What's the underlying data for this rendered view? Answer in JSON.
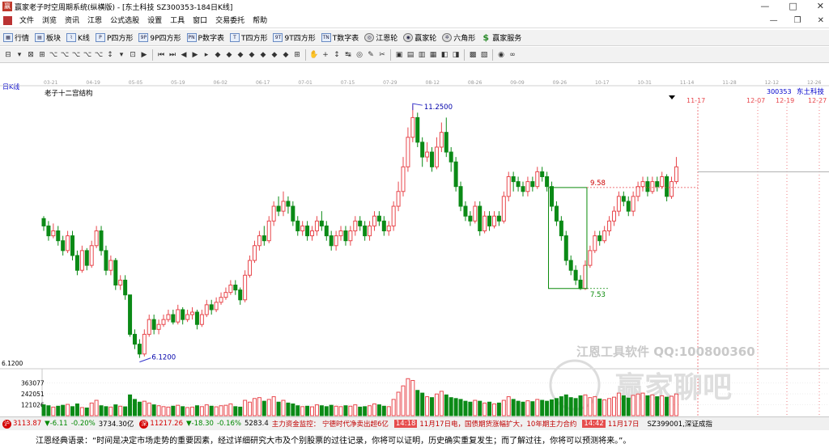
{
  "window": {
    "title": "赢家老子时空周期系统(纵横版) - [东土科技  SZ300353-184日K线]",
    "min_glyph": "—",
    "max_glyph": "□",
    "close_glyph": "✕"
  },
  "menu": {
    "items": [
      "文件",
      "浏览",
      "资讯",
      "江恩",
      "公式选股",
      "设置",
      "工具",
      "窗口",
      "交易委托",
      "帮助"
    ],
    "mdi_min": "—",
    "mdi_max": "❐",
    "mdi_close": "✕"
  },
  "toolbar": {
    "items": [
      {
        "label": "行情",
        "icon": "grid-icon"
      },
      {
        "label": "板块",
        "icon": "blocks-icon"
      },
      {
        "label": "K线",
        "icon": "kline-icon"
      },
      {
        "label": "P四方形",
        "icon": "p-square-icon"
      },
      {
        "label": "9P四方形",
        "icon": "9p-square-icon"
      },
      {
        "label": "P数字表",
        "icon": "p-table-icon"
      },
      {
        "label": "T四方形",
        "icon": "t-square-icon"
      },
      {
        "label": "9T四方形",
        "icon": "9t-square-icon"
      },
      {
        "label": "T数字表",
        "icon": "t-table-icon"
      },
      {
        "label": "江恩轮",
        "icon": "gann-wheel-icon"
      },
      {
        "label": "赢家轮",
        "icon": "winner-wheel-icon"
      },
      {
        "label": "六角形",
        "icon": "hexagon-icon"
      },
      {
        "label": "赢家服务",
        "icon": "yen-icon"
      }
    ]
  },
  "toolbar2": {
    "glyphs": [
      "⊟",
      "▾",
      "⊠",
      "⊞",
      "⌥",
      "⌥",
      "⌥",
      "⌥",
      "⌥",
      "↕",
      "▾",
      "⊡",
      "▶",
      "|",
      "⏮",
      "⏭",
      "◀",
      "▶",
      "▸",
      "◆",
      "◆",
      "◆",
      "◆",
      "◆",
      "◆",
      "◆",
      "⊞",
      "|",
      "✋",
      "+",
      "↕",
      "↹",
      "◎",
      "✎",
      "✂",
      "|",
      "▣",
      "▤",
      "▥",
      "▦",
      "◧",
      "◨",
      "|",
      "▩",
      "▧",
      "|",
      "◉",
      "∞"
    ]
  },
  "chart_data": {
    "type": "candlestick",
    "period_label": "日K线",
    "indicator_label": "老子十二宫结构",
    "stock_code": "300353",
    "stock_name": "东土科技",
    "date_ticks": [
      "03-21",
      "04-19",
      "05-05",
      "05-19",
      "06-02",
      "06-17",
      "07-01",
      "07-15",
      "07-29",
      "08-12",
      "08-26",
      "09-09",
      "09-26",
      "10-17",
      "10-31",
      "11-14",
      "11-28",
      "12-12",
      "12-26"
    ],
    "cycle_markers": [
      "11-17",
      "12-07",
      "12-19",
      "12-27"
    ],
    "annotations": {
      "high": "11.2500",
      "low": "6.1200",
      "box_top": "9.58",
      "box_bottom": "7.53",
      "y_axis_top_label": "6.1200"
    },
    "ylim": [
      5.95,
      11.45
    ],
    "volume_ticks": [
      "363077",
      "242051",
      "121026"
    ],
    "volume_ylim": [
      0,
      484000
    ],
    "candles": [
      [
        8.95,
        8.8,
        9.0,
        8.7
      ],
      [
        8.8,
        8.6,
        8.9,
        8.5
      ],
      [
        8.6,
        8.7,
        8.85,
        8.55
      ],
      [
        8.7,
        8.5,
        8.8,
        8.4
      ],
      [
        8.5,
        8.3,
        8.6,
        8.2
      ],
      [
        8.3,
        8.6,
        8.7,
        8.25
      ],
      [
        8.6,
        8.2,
        8.7,
        8.1
      ],
      [
        8.2,
        7.9,
        8.3,
        7.8
      ],
      [
        7.9,
        8.3,
        8.4,
        7.85
      ],
      [
        8.3,
        8.0,
        8.35,
        7.9
      ],
      [
        8.0,
        8.4,
        8.5,
        7.95
      ],
      [
        8.4,
        8.7,
        8.8,
        8.35
      ],
      [
        8.7,
        8.3,
        8.8,
        8.2
      ],
      [
        8.3,
        7.9,
        8.4,
        7.8
      ],
      [
        7.9,
        8.1,
        8.2,
        7.8
      ],
      [
        8.1,
        7.6,
        8.15,
        7.5
      ],
      [
        7.6,
        7.7,
        7.8,
        7.5
      ],
      [
        7.7,
        7.4,
        7.8,
        7.3
      ],
      [
        7.4,
        6.6,
        7.4,
        6.55
      ],
      [
        6.6,
        6.4,
        6.7,
        6.3
      ],
      [
        6.4,
        6.2,
        6.5,
        6.12
      ],
      [
        6.2,
        6.6,
        6.7,
        6.15
      ],
      [
        6.6,
        6.9,
        7.0,
        6.55
      ],
      [
        6.9,
        6.7,
        7.0,
        6.6
      ],
      [
        6.7,
        6.8,
        6.9,
        6.6
      ],
      [
        6.8,
        6.9,
        7.0,
        6.75
      ],
      [
        6.9,
        7.0,
        7.1,
        6.85
      ],
      [
        7.0,
        6.85,
        7.1,
        6.8
      ],
      [
        6.85,
        7.1,
        7.2,
        6.8
      ],
      [
        7.1,
        6.9,
        7.15,
        6.8
      ],
      [
        6.9,
        7.0,
        7.1,
        6.85
      ],
      [
        7.0,
        7.05,
        7.15,
        6.9
      ],
      [
        7.05,
        6.8,
        7.1,
        6.7
      ],
      [
        6.8,
        7.0,
        7.1,
        6.75
      ],
      [
        7.0,
        7.2,
        7.3,
        6.95
      ],
      [
        7.2,
        7.1,
        7.3,
        7.0
      ],
      [
        7.1,
        7.25,
        7.35,
        7.05
      ],
      [
        7.25,
        7.35,
        7.45,
        7.2
      ],
      [
        7.35,
        7.45,
        7.55,
        7.3
      ],
      [
        7.45,
        7.6,
        7.7,
        7.4
      ],
      [
        7.6,
        7.5,
        7.7,
        7.4
      ],
      [
        7.5,
        7.3,
        7.55,
        7.2
      ],
      [
        7.3,
        7.8,
        7.9,
        7.25
      ],
      [
        7.8,
        8.1,
        8.2,
        7.75
      ],
      [
        8.1,
        8.4,
        8.5,
        8.05
      ],
      [
        8.4,
        8.6,
        8.7,
        8.3
      ],
      [
        8.6,
        8.5,
        8.8,
        8.4
      ],
      [
        8.5,
        8.9,
        9.0,
        8.45
      ],
      [
        8.9,
        9.2,
        9.3,
        8.8
      ],
      [
        9.2,
        9.1,
        9.4,
        9.0
      ],
      [
        9.1,
        9.3,
        9.5,
        9.0
      ],
      [
        9.3,
        9.2,
        9.4,
        9.05
      ],
      [
        9.2,
        8.9,
        9.3,
        8.8
      ],
      [
        8.9,
        8.7,
        9.0,
        8.6
      ],
      [
        8.7,
        8.8,
        8.9,
        8.6
      ],
      [
        8.8,
        8.6,
        8.9,
        8.5
      ],
      [
        8.6,
        8.7,
        8.8,
        8.5
      ],
      [
        8.7,
        8.9,
        9.0,
        8.6
      ],
      [
        8.9,
        8.8,
        9.1,
        8.7
      ],
      [
        8.8,
        8.6,
        8.9,
        8.5
      ],
      [
        8.6,
        8.4,
        8.7,
        8.3
      ],
      [
        8.4,
        8.6,
        8.7,
        8.3
      ],
      [
        8.6,
        8.7,
        8.8,
        8.5
      ],
      [
        8.7,
        8.5,
        8.8,
        8.4
      ],
      [
        8.5,
        8.7,
        8.8,
        8.4
      ],
      [
        8.7,
        8.9,
        9.0,
        8.6
      ],
      [
        8.9,
        8.8,
        9.0,
        8.7
      ],
      [
        8.8,
        8.6,
        8.9,
        8.5
      ],
      [
        8.6,
        8.8,
        8.9,
        8.5
      ],
      [
        8.8,
        9.0,
        9.1,
        8.7
      ],
      [
        9.0,
        8.9,
        9.1,
        8.8
      ],
      [
        8.9,
        8.7,
        9.0,
        8.6
      ],
      [
        8.7,
        8.8,
        8.9,
        8.6
      ],
      [
        8.8,
        9.2,
        9.3,
        8.7
      ],
      [
        9.2,
        9.5,
        9.7,
        9.1
      ],
      [
        9.5,
        10.0,
        10.2,
        9.4
      ],
      [
        10.0,
        10.6,
        10.8,
        9.9
      ],
      [
        10.6,
        11.0,
        11.25,
        10.5
      ],
      [
        11.0,
        10.5,
        11.1,
        10.4
      ],
      [
        10.5,
        10.2,
        10.6,
        10.0
      ],
      [
        10.2,
        10.3,
        10.5,
        10.1
      ],
      [
        10.3,
        10.0,
        10.4,
        9.9
      ],
      [
        10.0,
        10.4,
        10.6,
        9.95
      ],
      [
        10.4,
        10.7,
        10.9,
        10.3
      ],
      [
        10.7,
        10.3,
        11.0,
        10.2
      ],
      [
        10.3,
        10.1,
        10.4,
        9.9
      ],
      [
        10.1,
        9.6,
        10.2,
        9.5
      ],
      [
        9.6,
        9.2,
        9.7,
        9.1
      ],
      [
        9.2,
        9.0,
        9.3,
        8.9
      ],
      [
        9.0,
        8.9,
        9.1,
        8.8
      ],
      [
        8.9,
        9.2,
        9.3,
        8.85
      ],
      [
        9.2,
        8.7,
        9.3,
        8.6
      ],
      [
        8.7,
        9.0,
        9.1,
        8.65
      ],
      [
        9.0,
        8.8,
        9.1,
        8.7
      ],
      [
        8.8,
        9.0,
        9.1,
        8.75
      ],
      [
        9.0,
        8.9,
        9.1,
        8.8
      ],
      [
        8.9,
        9.4,
        9.5,
        8.85
      ],
      [
        9.4,
        9.8,
        9.9,
        9.3
      ],
      [
        9.8,
        9.7,
        9.9,
        9.5
      ],
      [
        9.7,
        9.6,
        9.8,
        9.5
      ],
      [
        9.6,
        9.5,
        9.7,
        9.4
      ],
      [
        9.5,
        9.7,
        9.8,
        9.4
      ],
      [
        9.7,
        9.6,
        9.8,
        9.5
      ],
      [
        9.6,
        9.9,
        10.0,
        9.55
      ],
      [
        9.9,
        9.8,
        10.0,
        9.7
      ],
      [
        9.8,
        9.6,
        9.9,
        9.5
      ],
      [
        9.6,
        9.2,
        9.7,
        9.1
      ],
      [
        9.2,
        8.9,
        9.3,
        8.8
      ],
      [
        8.9,
        8.6,
        9.0,
        8.5
      ],
      [
        8.6,
        8.1,
        8.7,
        8.0
      ],
      [
        8.1,
        7.9,
        8.2,
        7.8
      ],
      [
        7.9,
        7.7,
        8.0,
        7.6
      ],
      [
        7.7,
        7.53,
        7.8,
        7.5
      ],
      [
        7.53,
        8.0,
        8.1,
        7.5
      ],
      [
        8.0,
        8.3,
        8.4,
        7.95
      ],
      [
        8.3,
        8.6,
        8.7,
        8.25
      ],
      [
        8.6,
        8.5,
        8.7,
        8.4
      ],
      [
        8.5,
        8.7,
        8.8,
        8.45
      ],
      [
        8.7,
        8.9,
        9.0,
        8.6
      ],
      [
        8.9,
        9.1,
        9.2,
        8.8
      ],
      [
        9.1,
        9.4,
        9.5,
        9.0
      ],
      [
        9.4,
        9.3,
        9.5,
        9.2
      ],
      [
        9.3,
        9.1,
        9.4,
        9.0
      ],
      [
        9.1,
        9.4,
        9.5,
        9.0
      ],
      [
        9.4,
        9.6,
        9.7,
        9.3
      ],
      [
        9.6,
        9.7,
        9.8,
        9.5
      ],
      [
        9.7,
        9.5,
        9.8,
        9.4
      ],
      [
        9.5,
        9.7,
        9.8,
        9.45
      ],
      [
        9.7,
        9.6,
        9.8,
        9.5
      ],
      [
        9.6,
        9.8,
        9.9,
        9.55
      ],
      [
        9.8,
        9.4,
        9.85,
        9.3
      ],
      [
        9.4,
        9.7,
        9.8,
        9.35
      ],
      [
        9.7,
        10.0,
        10.2,
        9.65
      ]
    ],
    "volumes": [
      120000,
      110000,
      95000,
      105000,
      115000,
      125000,
      100000,
      130000,
      90000,
      85000,
      140000,
      170000,
      110000,
      100000,
      95000,
      120000,
      105000,
      98000,
      230000,
      180000,
      150000,
      160000,
      140000,
      120000,
      110000,
      100000,
      95000,
      105000,
      115000,
      100000,
      90000,
      95000,
      110000,
      100000,
      120000,
      105000,
      98000,
      110000,
      115000,
      130000,
      100000,
      95000,
      170000,
      150000,
      190000,
      200000,
      160000,
      180000,
      210000,
      150000,
      170000,
      140000,
      130000,
      110000,
      100000,
      105000,
      98000,
      120000,
      110000,
      100000,
      115000,
      105000,
      100000,
      110000,
      105000,
      120000,
      95000,
      100000,
      110000,
      130000,
      120000,
      105000,
      100000,
      180000,
      260000,
      330000,
      410000,
      390000,
      280000,
      250000,
      210000,
      200000,
      240000,
      270000,
      230000,
      200000,
      190000,
      180000,
      160000,
      150000,
      170000,
      160000,
      140000,
      150000,
      130000,
      140000,
      170000,
      210000,
      180000,
      160000,
      150000,
      165000,
      155000,
      180000,
      170000,
      160000,
      175000,
      190000,
      210000,
      230000,
      200000,
      190000,
      220000,
      230000,
      200000,
      210000,
      185000,
      175000,
      190000,
      205000,
      250000,
      220000,
      195000,
      225000,
      240000,
      250000,
      220000,
      230000,
      210000,
      220000,
      205000,
      215000,
      240000
    ]
  },
  "watermark": {
    "text1": "江恩工具软件  QQ:100800360",
    "text2": "赢家聊吧"
  },
  "statusbar": {
    "sh_index": "3113.87",
    "sh_change": "▼-6.11",
    "sh_pct": "-0.20%",
    "sh_amount": "3734.30亿",
    "sz_index": "11217.26",
    "sz_change": "▼-18.30",
    "sz_pct": "-0.16%",
    "sz_amount": "5283.4",
    "ticker_text": "主力资金监控：  宁德时代净卖出超6亿",
    "time1": "14:18",
    "news": "11月17日电，国债期货涨幅扩大，10年期主力合约",
    "time2": "14:42",
    "date2": "11月17日",
    "right_code": "SZ399001,深证成指",
    "sh_badge": "沪",
    "sz_badge": "深"
  },
  "quote": {
    "text": "江恩经典语录：“时间是决定市场走势的重要因素，经过详细研究大市及个别股票的过往记录，你将可以证明，历史确实重复发生；而了解过往，你将可以预测将来。”。"
  },
  "colors": {
    "up": "#e8474c",
    "down": "#0b8a16",
    "grid": "#c8c8c8",
    "accent_blue": "#0000cc",
    "marker_red": "#e8474c"
  }
}
